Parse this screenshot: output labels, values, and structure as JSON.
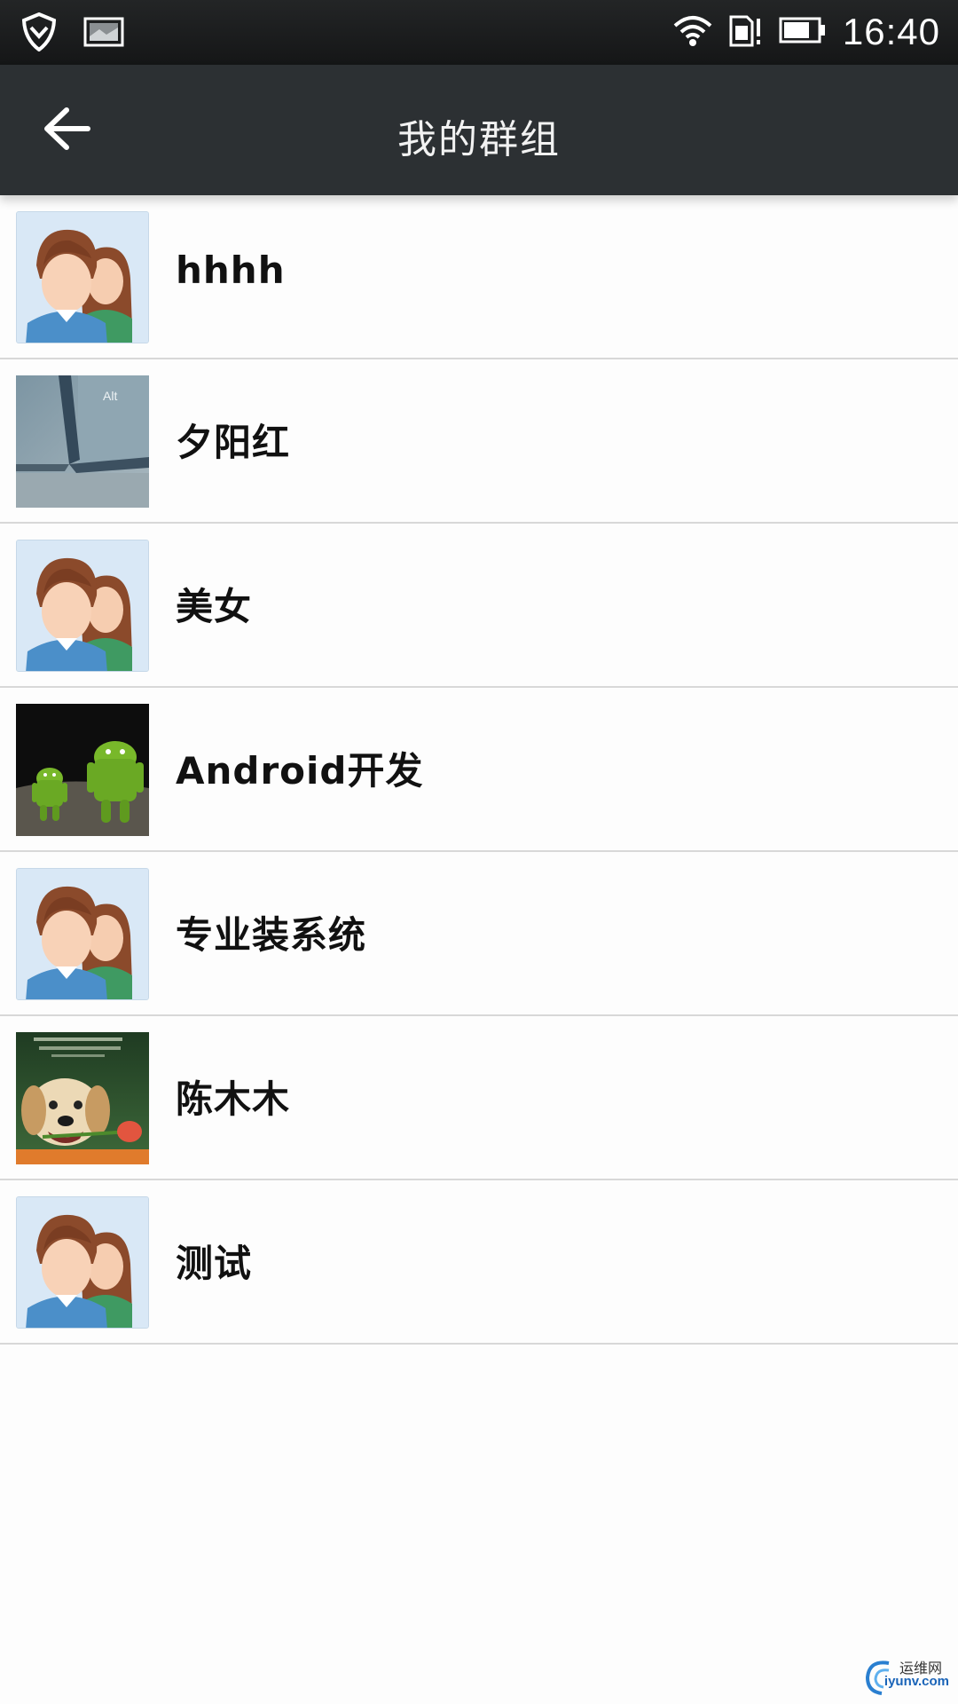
{
  "status_bar": {
    "time": "16:40",
    "icons": [
      "shield-icon",
      "image-notification-icon",
      "wifi-icon",
      "sim-warning-icon",
      "battery-icon"
    ]
  },
  "app_bar": {
    "title": "我的群组",
    "back_icon": "arrow-left-icon"
  },
  "groups": [
    {
      "name": "hhhh",
      "avatar": "default-couple-avatar"
    },
    {
      "name": "夕阳红",
      "avatar": "keyboard-alt-key-photo"
    },
    {
      "name": "美女",
      "avatar": "default-couple-avatar"
    },
    {
      "name": "Android开发",
      "avatar": "android-robots-photo"
    },
    {
      "name": "专业装系统",
      "avatar": "default-couple-avatar"
    },
    {
      "name": "陈木木",
      "avatar": "puppy-with-rose-photo"
    },
    {
      "name": "测试",
      "avatar": "default-couple-avatar"
    }
  ],
  "watermark": {
    "line1": "运维网",
    "line2": "iyunv.com"
  },
  "colors": {
    "status_bar_bg": "#1b1c1d",
    "app_bar_bg": "#2c3033",
    "list_bg": "#fdfdfd",
    "divider": "#d8d8d8"
  }
}
